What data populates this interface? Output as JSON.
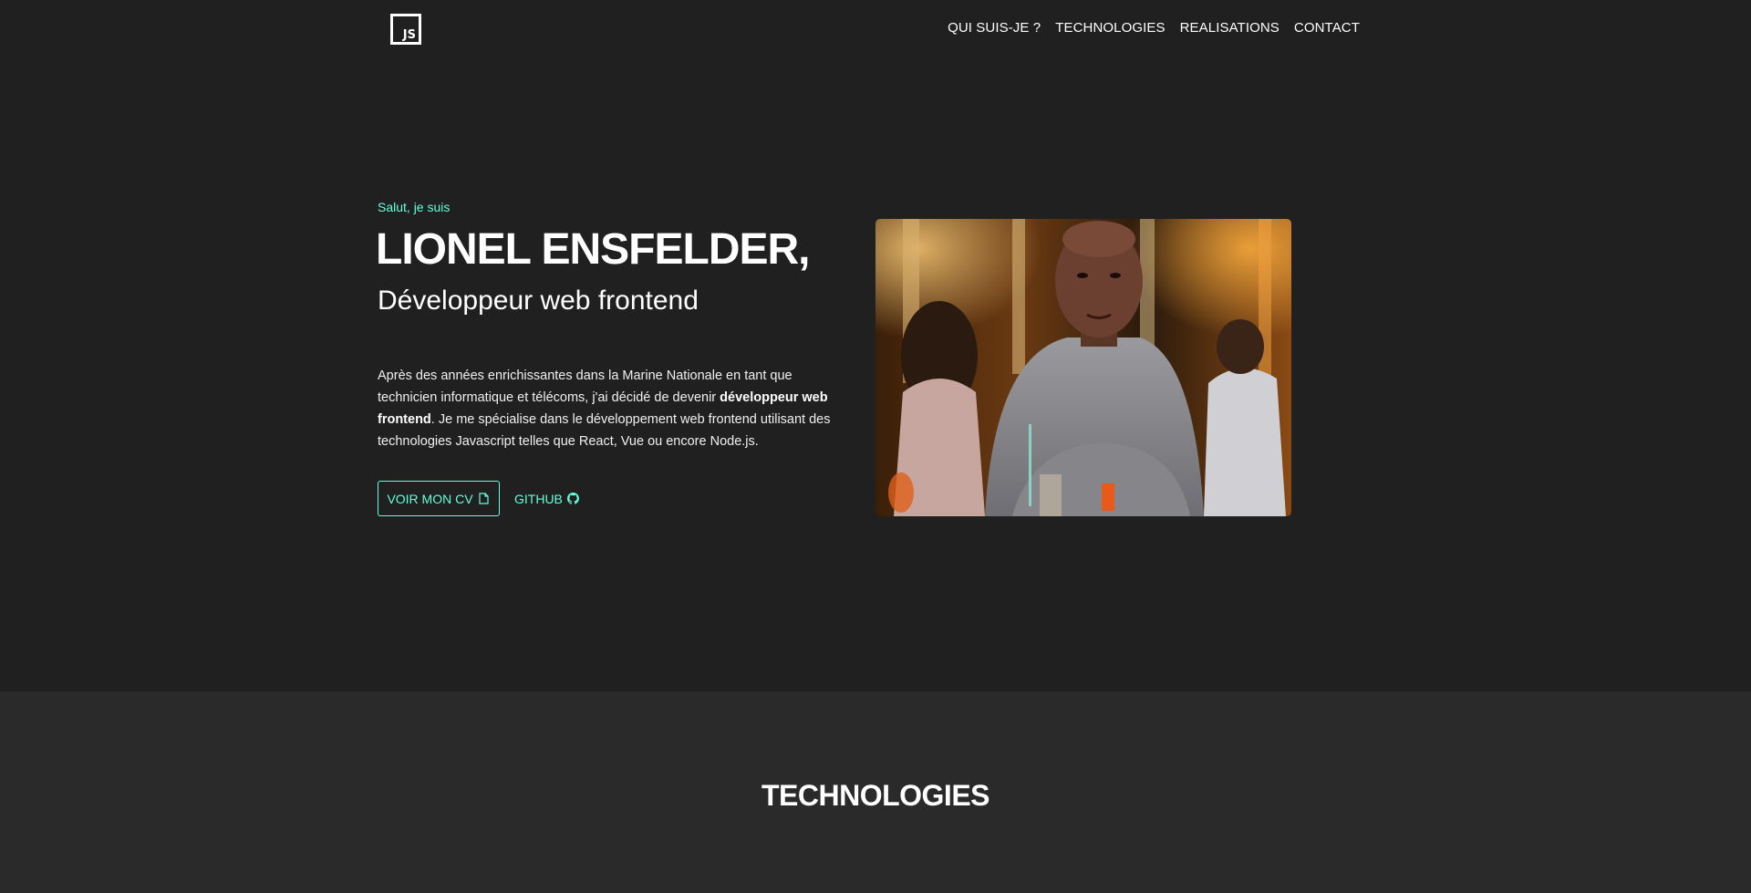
{
  "nav": {
    "logo_text": "JS",
    "links": [
      "QUI SUIS-JE ?",
      "TECHNOLOGIES",
      "REALISATIONS",
      "CONTACT"
    ]
  },
  "hero": {
    "greeting": "Salut, je suis",
    "name": "LIONEL ENSFELDER,",
    "role": "Développeur web frontend",
    "bio_before": "Après des années enrichissantes dans la Marine Nationale en tant que technicien informatique et télécoms, j'ai décidé de devenir ",
    "bio_bold": "développeur web frontend",
    "bio_after": ". Je me spécialise dans le développement web frontend utilisant des technologies Javascript telles que React, Vue ou encore Node.js.",
    "cv_button_label": "VOIR MON CV",
    "github_label": "GITHUB",
    "cv_icon": "file-icon",
    "github_icon": "github-icon"
  },
  "technologies": {
    "title": "TECHNOLOGIES"
  },
  "colors": {
    "accent": "#64ffda",
    "background": "#202020",
    "section_background": "#2a2a2a",
    "text": "#ffffff"
  }
}
